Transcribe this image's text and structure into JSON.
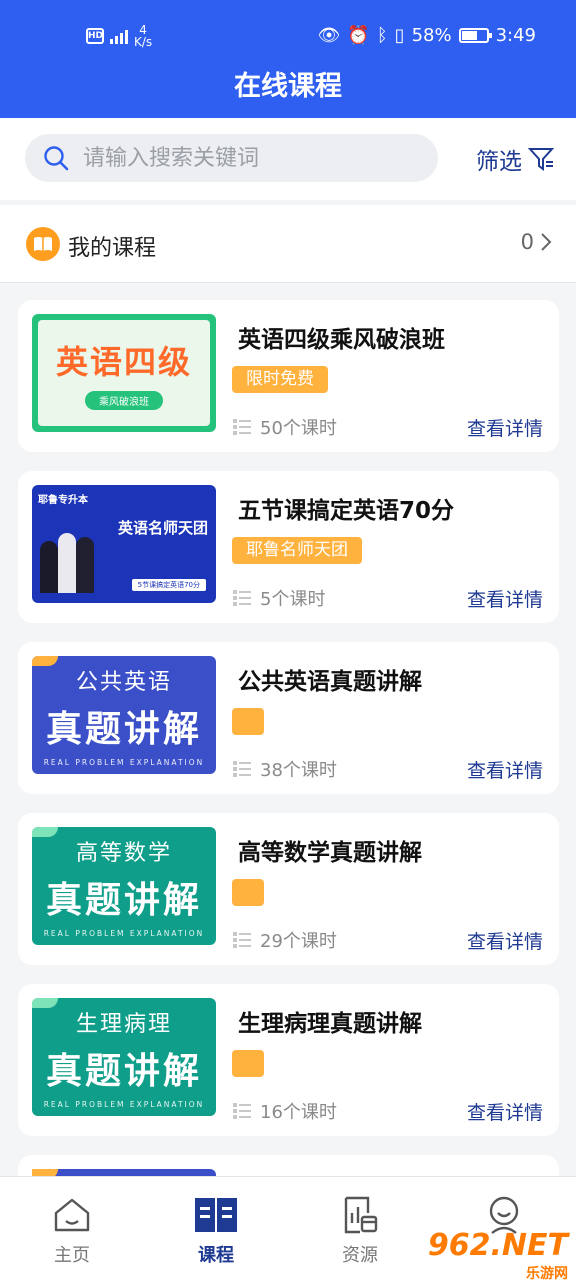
{
  "status_bar": {
    "hd": "HD",
    "net": "5G",
    "speed_value": "4",
    "speed_unit": "K/s",
    "battery": "58%",
    "time": "3:49"
  },
  "header": {
    "title": "在线课程"
  },
  "search": {
    "placeholder": "请输入搜索关键词",
    "filter_label": "筛选"
  },
  "my_courses": {
    "label": "我的课程",
    "count": "0"
  },
  "courses": [
    {
      "thumb_small": "",
      "thumb_big": "英语四级",
      "thumb_sub": "乘风破浪班",
      "title": "英语四级乘风破浪班",
      "tag": "限时免费",
      "lessons": "50个课时",
      "detail": "查看详情"
    },
    {
      "thumb_small": "耶鲁专升本",
      "thumb_big": "英语名师天团",
      "thumb_sub": "5节课搞定英语70分",
      "title": "五节课搞定英语70分",
      "tag": "耶鲁名师天团",
      "lessons": "5个课时",
      "detail": "查看详情"
    },
    {
      "thumb_small": "公共英语",
      "thumb_big": "真题讲解",
      "thumb_sub": "REAL PROBLEM EXPLANATION",
      "title": "公共英语真题讲解",
      "tag": "",
      "lessons": "38个课时",
      "detail": "查看详情"
    },
    {
      "thumb_small": "高等数学",
      "thumb_big": "真题讲解",
      "thumb_sub": "REAL PROBLEM EXPLANATION",
      "title": "高等数学真题讲解",
      "tag": "",
      "lessons": "29个课时",
      "detail": "查看详情"
    },
    {
      "thumb_small": "生理病理",
      "thumb_big": "真题讲解",
      "thumb_sub": "REAL PROBLEM EXPLANATION",
      "title": "生理病理真题讲解",
      "tag": "",
      "lessons": "16个课时",
      "detail": "查看详情"
    }
  ],
  "nav": [
    {
      "label": "主页",
      "icon": "home-icon"
    },
    {
      "label": "课程",
      "icon": "book-icon",
      "active": true
    },
    {
      "label": "资源",
      "icon": "resource-icon"
    },
    {
      "label": "",
      "icon": "profile-icon"
    }
  ],
  "watermark": {
    "main": "962.NET",
    "sub": "乐游网"
  },
  "colors": {
    "header": "#2f5ff0",
    "accent": "#1f3a93",
    "tag": "#ffb23e",
    "english_thumb": "#3a4fc8",
    "green_thumb": "#0f9e8a"
  }
}
